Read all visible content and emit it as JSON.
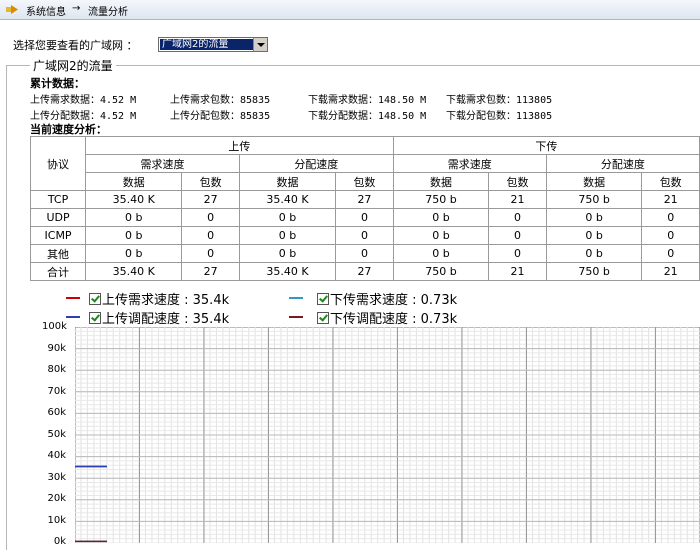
{
  "breadcrumb": {
    "part1": "系统信息",
    "arrow": "→",
    "part2": "流量分析"
  },
  "selector": {
    "label": "选择您要查看的广域网 ：",
    "selected": "广域网2的流量"
  },
  "panel": {
    "title": "广域网2的流量"
  },
  "cumulative": {
    "heading": "累计数据：",
    "row1": {
      "up_req_data": "上传需求数据：4.52 M",
      "up_req_pkts": "上传需求包数：85835",
      "down_req_data": "下载需求数据：148.50 M",
      "down_req_pkts": "下载需求包数：113805"
    },
    "row2": {
      "up_alloc_data": "上传分配数据：4.52 M",
      "up_alloc_pkts": "上传分配包数：85835",
      "down_alloc_data": "下载分配数据：148.50 M",
      "down_alloc_pkts": "下载分配包数：113805"
    }
  },
  "speed": {
    "heading": "当前速度分析：",
    "headers": {
      "protocol": "协议",
      "upload": "上传",
      "download": "下传",
      "req_speed": "需求速度",
      "alloc_speed": "分配速度",
      "data": "数据",
      "packets": "包数"
    },
    "rows": [
      [
        "TCP",
        "35.40 K",
        "27",
        "35.40 K",
        "27",
        "750 b",
        "21",
        "750 b",
        "21"
      ],
      [
        "UDP",
        "0 b",
        "0",
        "0 b",
        "0",
        "0 b",
        "0",
        "0 b",
        "0"
      ],
      [
        "ICMP",
        "0 b",
        "0",
        "0 b",
        "0",
        "0 b",
        "0",
        "0 b",
        "0"
      ],
      [
        "其他",
        "0 b",
        "0",
        "0 b",
        "0",
        "0 b",
        "0",
        "0 b",
        "0"
      ],
      [
        "合计",
        "35.40 K",
        "27",
        "35.40 K",
        "27",
        "750 b",
        "21",
        "750 b",
        "21"
      ]
    ]
  },
  "chart_legend": {
    "up_req": "上传需求速度 : 35.4k",
    "up_alloc": "上传调配速度 : 35.4k",
    "down_req": "下传需求速度 : 0.73k",
    "down_alloc": "下传调配速度 : 0.73k"
  },
  "chart_data": {
    "type": "line",
    "yticks": [
      "100k",
      "90k",
      "80k",
      "70k",
      "60k",
      "50k",
      "40k",
      "30k",
      "20k",
      "10k",
      "0k"
    ],
    "ylim": [
      0,
      100
    ],
    "series": [
      {
        "name": "上传需求速度",
        "color": "#cc0000",
        "values": [
          35.4
        ]
      },
      {
        "name": "上传调配速度",
        "color": "#2a3fb0",
        "values": [
          35.4
        ]
      },
      {
        "name": "下传需求速度",
        "color": "#3399cc",
        "values": [
          0.73
        ]
      },
      {
        "name": "下传调配速度",
        "color": "#7a1a1a",
        "values": [
          0.73
        ]
      }
    ]
  },
  "colors": {
    "up_req": "#cc0000",
    "up_alloc": "#2a3fb0",
    "down_req": "#3399cc",
    "down_alloc": "#7a1a1a"
  }
}
